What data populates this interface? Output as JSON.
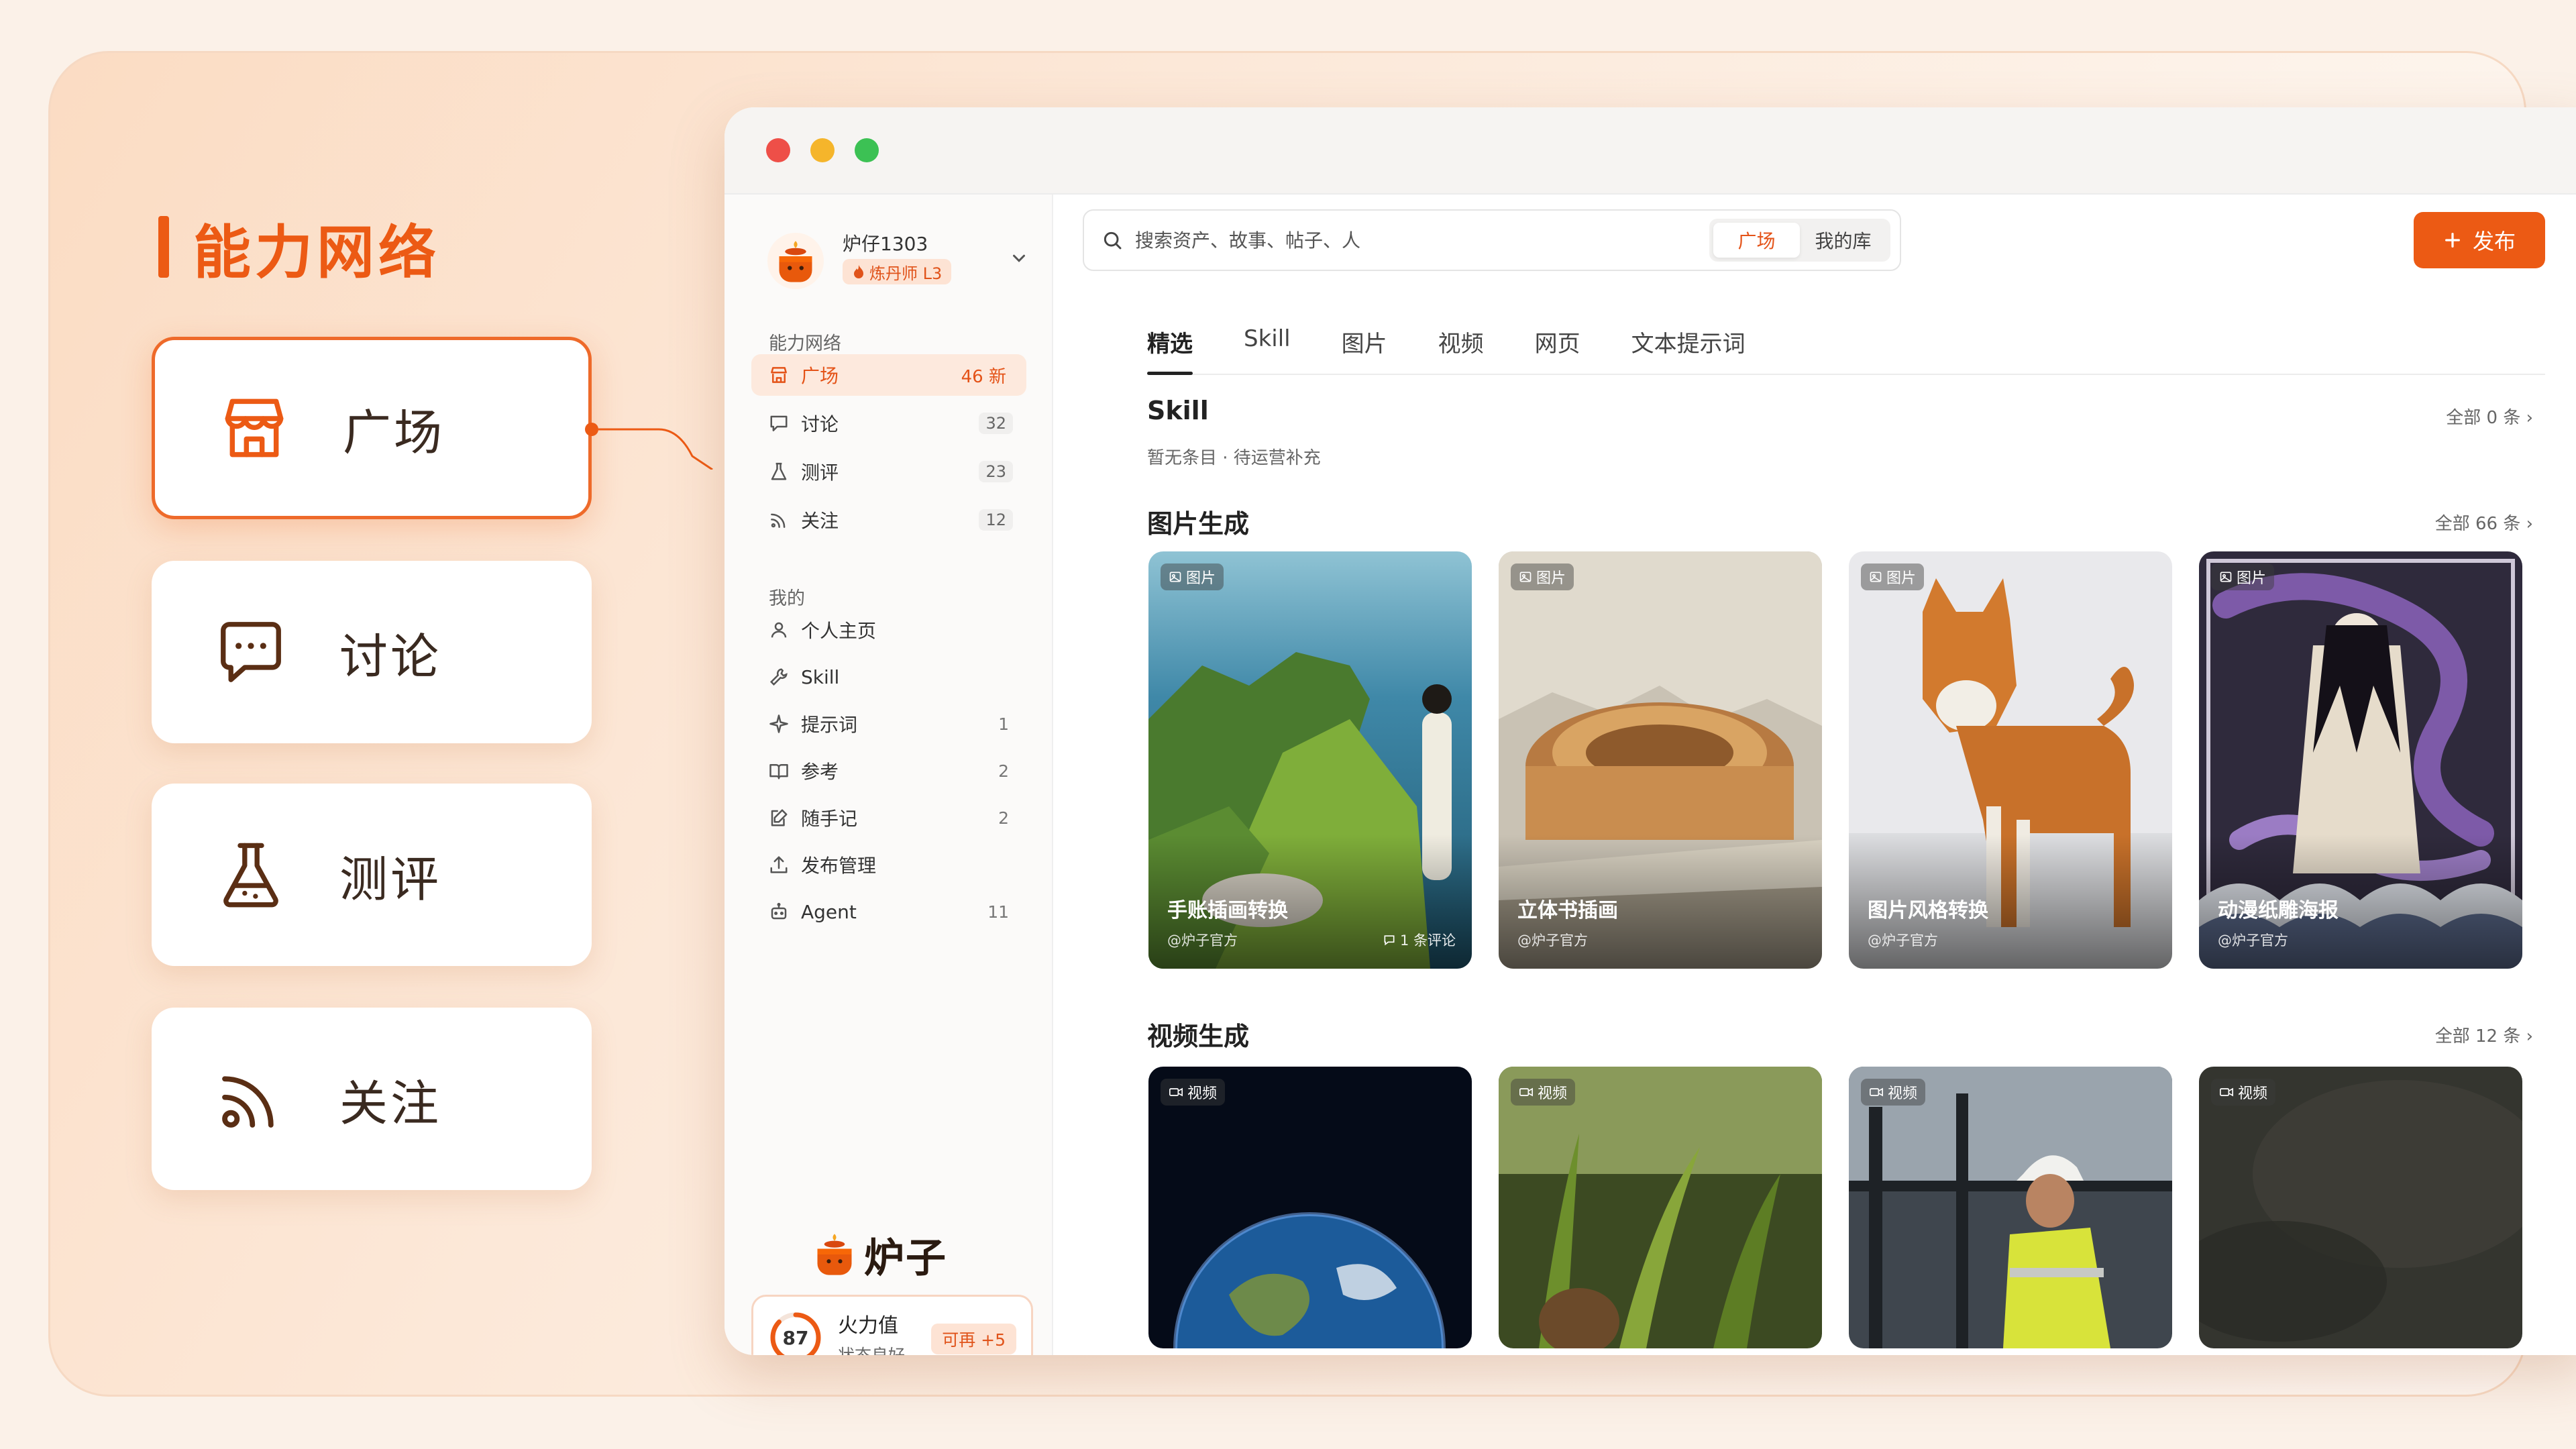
{
  "features": {
    "title": "能力网络",
    "items": [
      {
        "label": "广场",
        "icon": "storefront-icon",
        "active": true
      },
      {
        "label": "讨论",
        "icon": "chat-bubble-icon",
        "active": false
      },
      {
        "label": "测评",
        "icon": "flask-icon",
        "active": false
      },
      {
        "label": "关注",
        "icon": "rss-feed-icon",
        "active": false
      }
    ]
  },
  "sidebar": {
    "user": {
      "name": "炉仔1303",
      "level": "炼丹师 L3"
    },
    "section_network": "能力网络",
    "network_items": [
      {
        "label": "广场",
        "count": "46 新",
        "icon": "storefront-icon"
      },
      {
        "label": "讨论",
        "count": "32",
        "icon": "chat-bubble-icon"
      },
      {
        "label": "测评",
        "count": "23",
        "icon": "flask-icon"
      },
      {
        "label": "关注",
        "count": "12",
        "icon": "rss-feed-icon"
      }
    ],
    "section_mine": "我的",
    "mine_items": [
      {
        "label": "个人主页",
        "count": "",
        "icon": "person-icon"
      },
      {
        "label": "Skill",
        "count": "",
        "icon": "wrench-icon"
      },
      {
        "label": "提示词",
        "count": "1",
        "icon": "sparkle-icon"
      },
      {
        "label": "参考",
        "count": "2",
        "icon": "book-icon"
      },
      {
        "label": "随手记",
        "count": "2",
        "icon": "note-edit-icon"
      },
      {
        "label": "发布管理",
        "count": "",
        "icon": "upload-icon"
      },
      {
        "label": "Agent",
        "count": "11",
        "icon": "robot-icon"
      }
    ],
    "brand": "炉子",
    "fire": {
      "value": "87",
      "title": "火力值",
      "status": "状态良好",
      "boost": "可再 +5",
      "fraction": 0.87
    }
  },
  "header": {
    "search_placeholder": "搜索资产、故事、帖子、人",
    "scope_options": [
      "广场",
      "我的库"
    ],
    "publish_label": "发布"
  },
  "tabs": [
    "精选",
    "Skill",
    "图片",
    "视频",
    "网页",
    "文本提示词"
  ],
  "sections": {
    "skill": {
      "title": "Skill",
      "subtitle": "暂无条目 · 待运营补充",
      "see_all": "全部 0 条 ›"
    },
    "image": {
      "title": "图片生成",
      "see_all": "全部 66 条 ›",
      "cards": [
        {
          "badge": "图片",
          "title": "手账插画转换",
          "author": "@炉子官方",
          "comments": "1 条评论"
        },
        {
          "badge": "图片",
          "title": "立体书插画",
          "author": "@炉子官方",
          "comments": ""
        },
        {
          "badge": "图片",
          "title": "图片风格转换",
          "author": "@炉子官方",
          "comments": ""
        },
        {
          "badge": "图片",
          "title": "动漫纸雕海报",
          "author": "@炉子官方",
          "comments": ""
        }
      ]
    },
    "video": {
      "title": "视频生成",
      "see_all": "全部 12 条 ›",
      "cards": [
        {
          "badge": "视频"
        },
        {
          "badge": "视频"
        },
        {
          "badge": "视频"
        },
        {
          "badge": "视频"
        }
      ]
    }
  },
  "colors": {
    "accent": "#ec5a14",
    "accent_soft": "#fde3d4",
    "text": "#2b2b2b"
  }
}
